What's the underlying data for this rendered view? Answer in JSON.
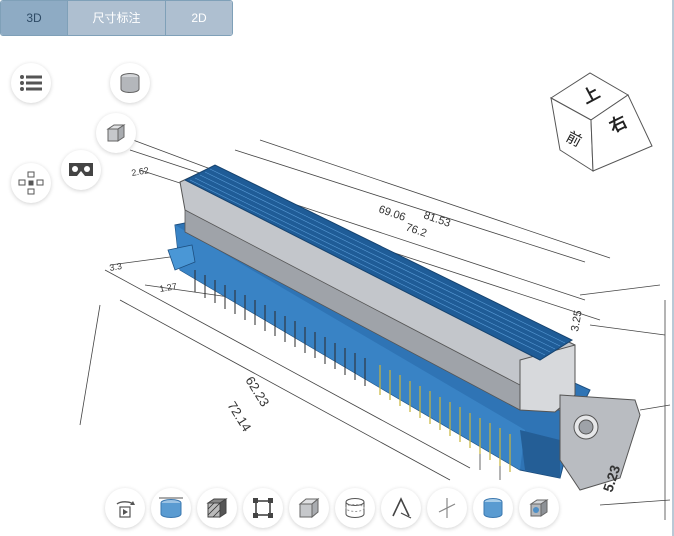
{
  "tabs": [
    {
      "label": "3D",
      "active": true
    },
    {
      "label": "尺寸标注",
      "active": false
    },
    {
      "label": "2D",
      "active": false
    }
  ],
  "left_tools": [
    {
      "icon": "list-icon"
    },
    {
      "icon": "cylinder-view-icon"
    },
    {
      "icon": "cube-view-icon"
    },
    {
      "icon": "vr-headset-icon"
    },
    {
      "icon": "explode-view-icon"
    }
  ],
  "view_cube": {
    "top": "上",
    "front": "前",
    "right": "右"
  },
  "dimensions": {
    "d1": "69.06",
    "d2": "81.53",
    "d3": "76.2",
    "d4": "62.23",
    "d5": "72.14",
    "d6": "5.23",
    "d7": "3.25",
    "d8": "1.27",
    "d9": "3.3",
    "d10": "2.62"
  },
  "bottom_toolbar": [
    {
      "icon": "rotate-play-icon"
    },
    {
      "icon": "fit-view-icon"
    },
    {
      "icon": "hatch-section-icon"
    },
    {
      "icon": "frame-select-icon"
    },
    {
      "icon": "box-icon"
    },
    {
      "icon": "cylinder-wire-icon"
    },
    {
      "icon": "measure-icon"
    },
    {
      "icon": "axis-icon"
    },
    {
      "icon": "cylinder-solid-icon"
    },
    {
      "icon": "settings-cube-icon"
    }
  ],
  "colors": {
    "body_blue": "#2f74b5",
    "housing_grey": "#b9bcc1",
    "pin_gold": "#c9b43a",
    "tab_bg": "#aebfd0"
  }
}
